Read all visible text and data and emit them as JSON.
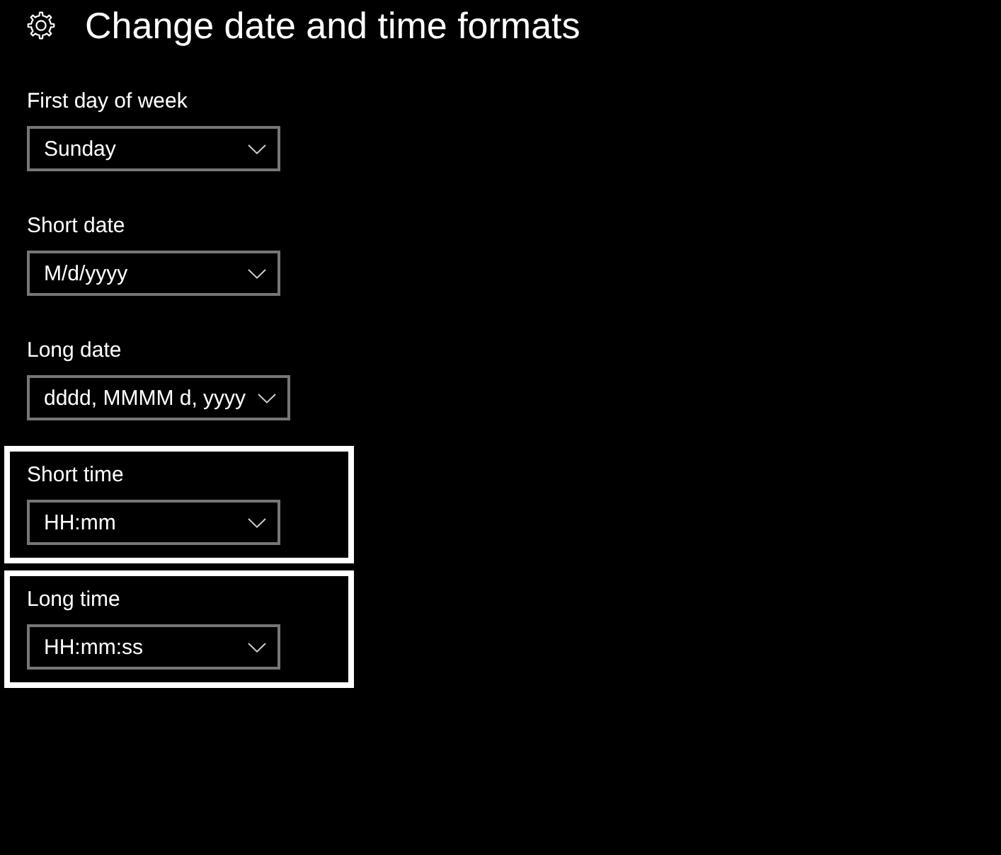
{
  "header": {
    "title": "Change date and time formats"
  },
  "fields": [
    {
      "label": "First day of week",
      "value": "Sunday",
      "highlighted": false
    },
    {
      "label": "Short date",
      "value": "M/d/yyyy",
      "highlighted": false
    },
    {
      "label": "Long date",
      "value": "dddd, MMMM d, yyyy",
      "highlighted": false
    },
    {
      "label": "Short time",
      "value": "HH:mm",
      "highlighted": true
    },
    {
      "label": "Long time",
      "value": "HH:mm:ss",
      "highlighted": true
    }
  ]
}
